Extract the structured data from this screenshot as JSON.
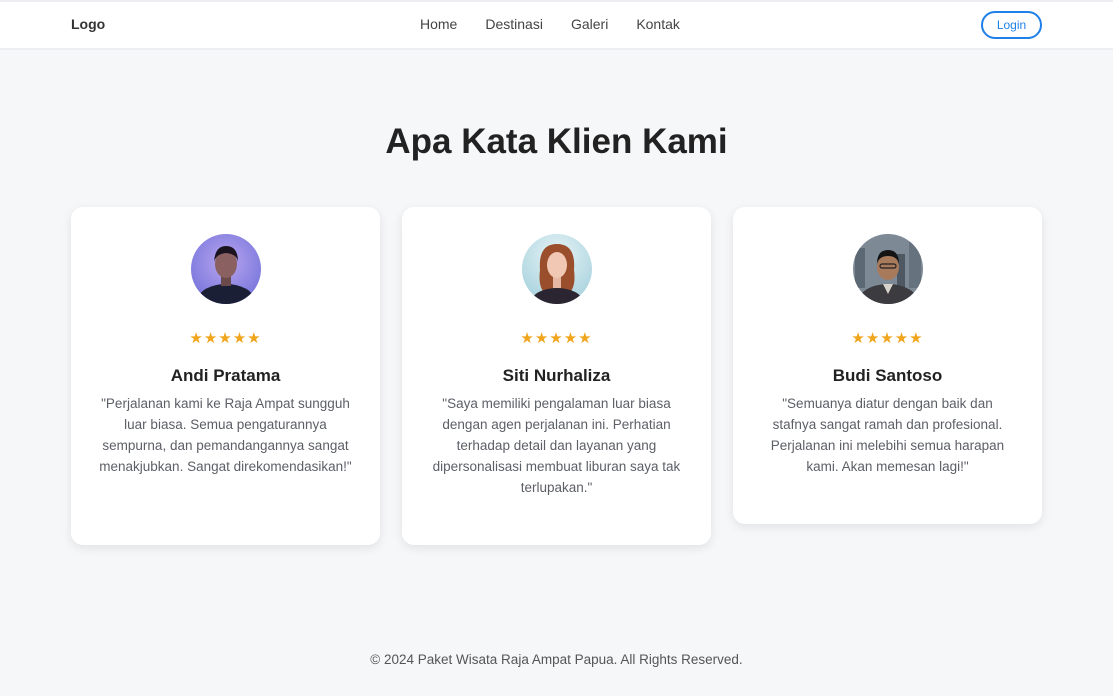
{
  "navbar": {
    "logo": "Logo",
    "links": [
      "Home",
      "Destinasi",
      "Galeri",
      "Kontak"
    ],
    "login_label": "Login"
  },
  "section": {
    "title": "Apa Kata Klien Kami"
  },
  "testimonials": [
    {
      "name": "Andi Pratama",
      "stars": "★★★★★",
      "rating": 5,
      "quote": "\"Perjalanan kami ke Raja Ampat sungguh luar biasa. Semua pengaturannya sempurna, dan pemandangannya sangat menakjubkan. Sangat direkomendasikan!\""
    },
    {
      "name": "Siti Nurhaliza",
      "stars": "★★★★★",
      "rating": 5,
      "quote": "\"Saya memiliki pengalaman luar biasa dengan agen perjalanan ini. Perhatian terhadap detail dan layanan yang dipersonalisasi membuat liburan saya tak terlupakan.\""
    },
    {
      "name": "Budi Santoso",
      "stars": "★★★★★",
      "rating": 5,
      "quote": "\"Semuanya diatur dengan baik dan stafnya sangat ramah dan profesional. Perjalanan ini melebihi semua harapan kami. Akan memesan lagi!\""
    }
  ],
  "footer": {
    "copyright": "© 2024 Paket Wisata Raja Ampat Papua. All Rights Reserved."
  },
  "colors": {
    "accent": "#1e80e8",
    "star": "#f0a51c",
    "background": "#f6f7f9"
  }
}
